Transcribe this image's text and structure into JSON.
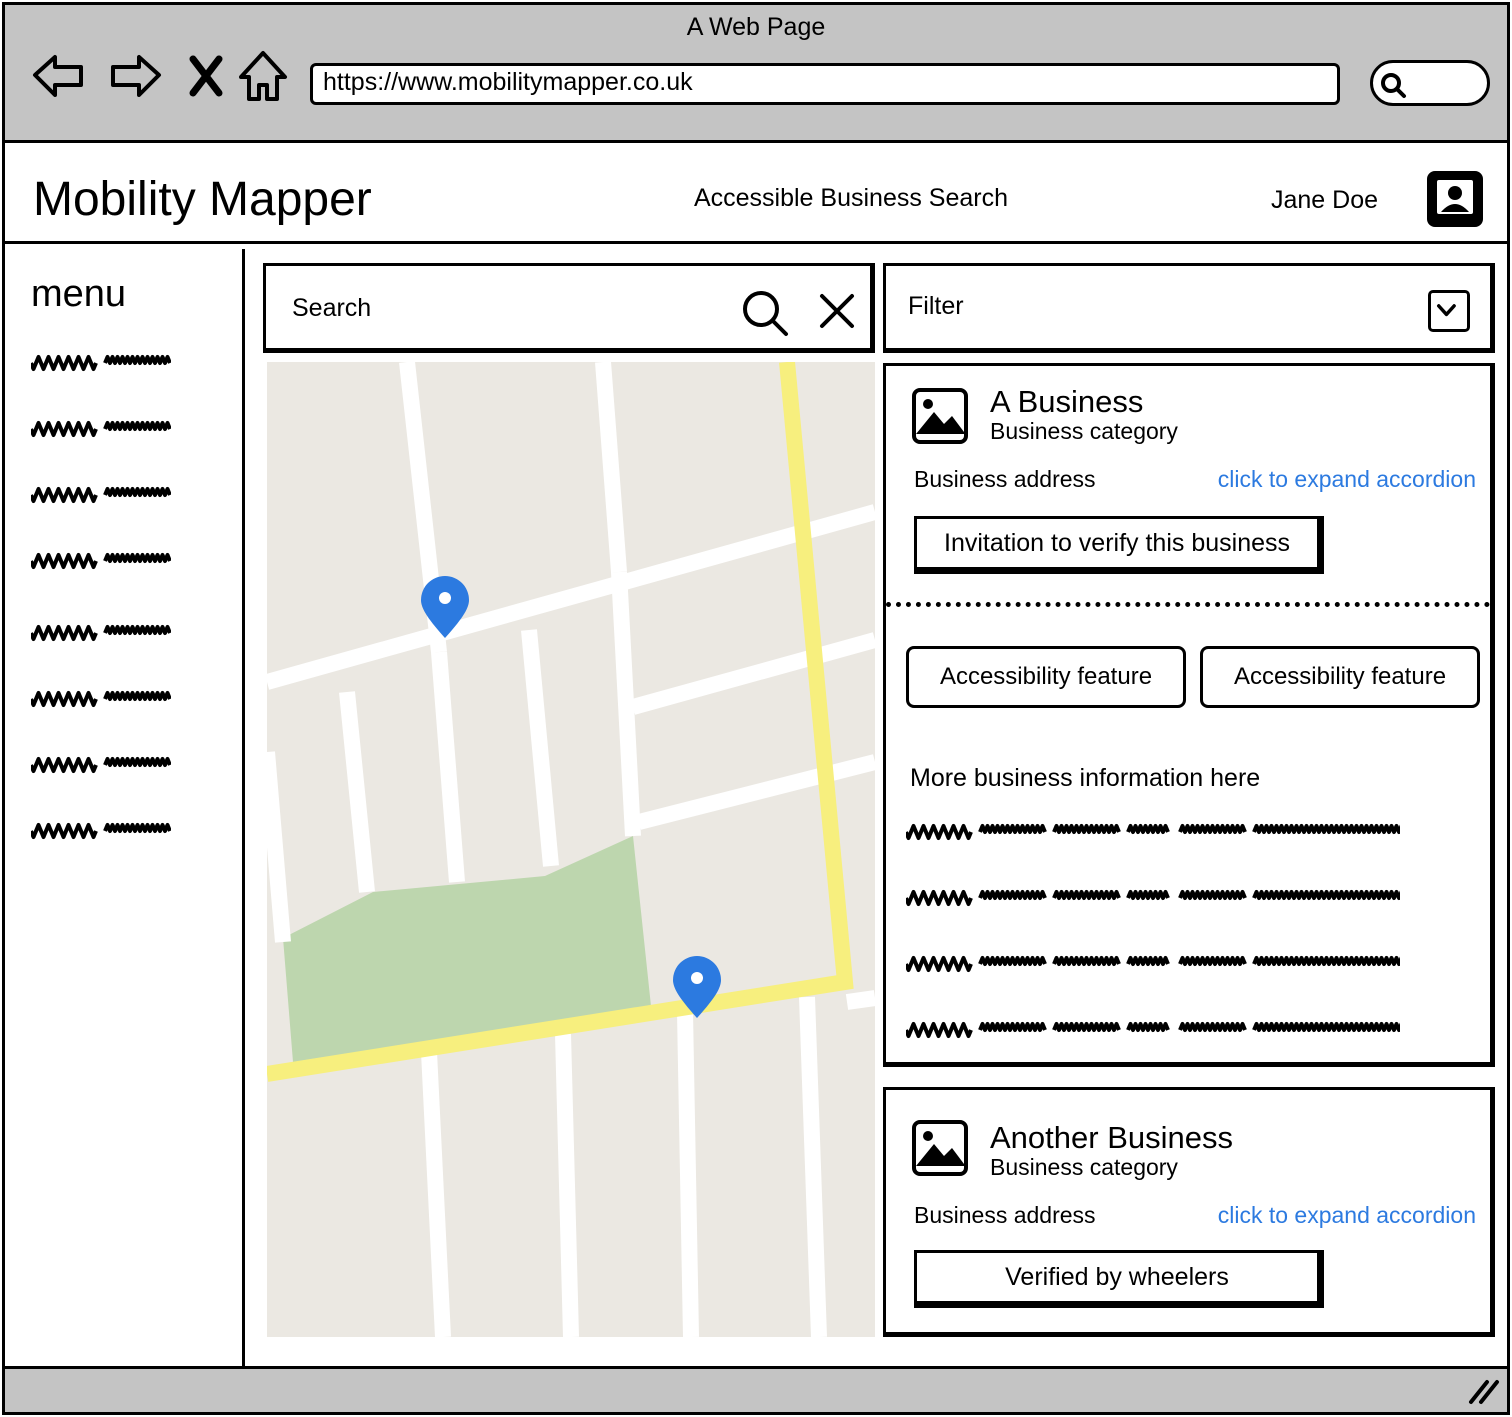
{
  "window": {
    "title": "A Web Page"
  },
  "browser": {
    "url": "https://www.mobilitymapper.co.uk",
    "icons": [
      "back-arrow-icon",
      "forward-arrow-icon",
      "close-icon",
      "home-icon",
      "search-icon"
    ]
  },
  "header": {
    "app_title": "Mobility Mapper",
    "subtitle": "Accessible Business Search",
    "user_name": "Jane Doe",
    "avatar_icon": "user-avatar-icon"
  },
  "sidebar": {
    "title": "menu",
    "item_count_visible": 8
  },
  "search": {
    "label": "Search"
  },
  "filter": {
    "label": "Filter"
  },
  "map": {
    "pins": 2,
    "colors": {
      "background": "#ebe8e2",
      "road": "#ffffff",
      "highway": "#f7ef7e",
      "park": "#bdd6ae",
      "pin": "#2c7ae0"
    }
  },
  "results": [
    {
      "name": "A Business",
      "category": "Business category",
      "address": "Business address",
      "expand_link": "click to expand accordion",
      "button": "Invitation to verify this business",
      "features": [
        "Accessibility feature",
        "Accessibility feature"
      ],
      "more_info_title": "More business information here"
    },
    {
      "name": "Another Business",
      "category": "Business category",
      "address": "Business address",
      "expand_link": "click to expand accordion",
      "button": "Verified by wheelers"
    }
  ],
  "colors": {
    "chrome": "#c4c4c4",
    "link": "#2c7ae0"
  }
}
